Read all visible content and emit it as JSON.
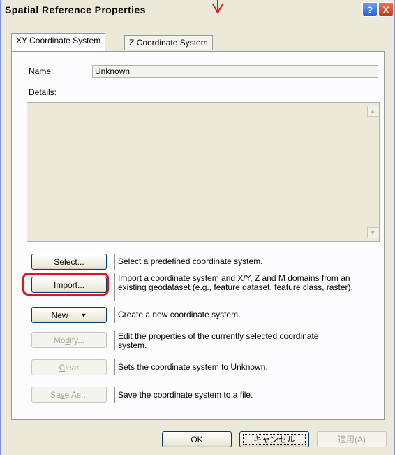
{
  "window": {
    "title": "Spatial Reference Properties",
    "help_symbol": "?",
    "close_symbol": "X"
  },
  "tabs": [
    {
      "label": "XY Coordinate System",
      "active": true
    },
    {
      "label": "Z Coordinate System",
      "active": false
    }
  ],
  "name_label": "Name:",
  "name_value": "Unknown",
  "details_label": "Details:",
  "actions": [
    {
      "label_pre": "",
      "accel": "S",
      "label_post": "elect...",
      "description": "Select a predefined coordinate system.",
      "enabled": true
    },
    {
      "label_pre": "",
      "accel": "I",
      "label_post": "mport...",
      "description": "Import a coordinate system and X/Y, Z and M domains from an existing geodataset (e.g., feature dataset, feature class, raster).",
      "enabled": true,
      "highlighted": true
    },
    {
      "label_pre": "",
      "accel": "N",
      "label_post": "ew",
      "description": "Create a new coordinate system.",
      "enabled": true,
      "dropdown_symbol": "▼"
    },
    {
      "label_pre": "Mo",
      "accel": "d",
      "label_post": "ify...",
      "description": "Edit the properties of the currently selected coordinate system.",
      "enabled": false
    },
    {
      "label_pre": "",
      "accel": "C",
      "label_post": "lear",
      "description": "Sets the coordinate system to Unknown.",
      "enabled": false
    },
    {
      "label_pre": "Sa",
      "accel": "v",
      "label_post": "e As...",
      "description": "Save the coordinate system to a file.",
      "enabled": false
    }
  ],
  "footer": {
    "ok_label": "OK",
    "cancel_label": "キャンセル",
    "apply_label": "適用(A)"
  },
  "colors": {
    "highlight_ring": "#e8101b",
    "annotation_arrow": "#e8101b"
  }
}
